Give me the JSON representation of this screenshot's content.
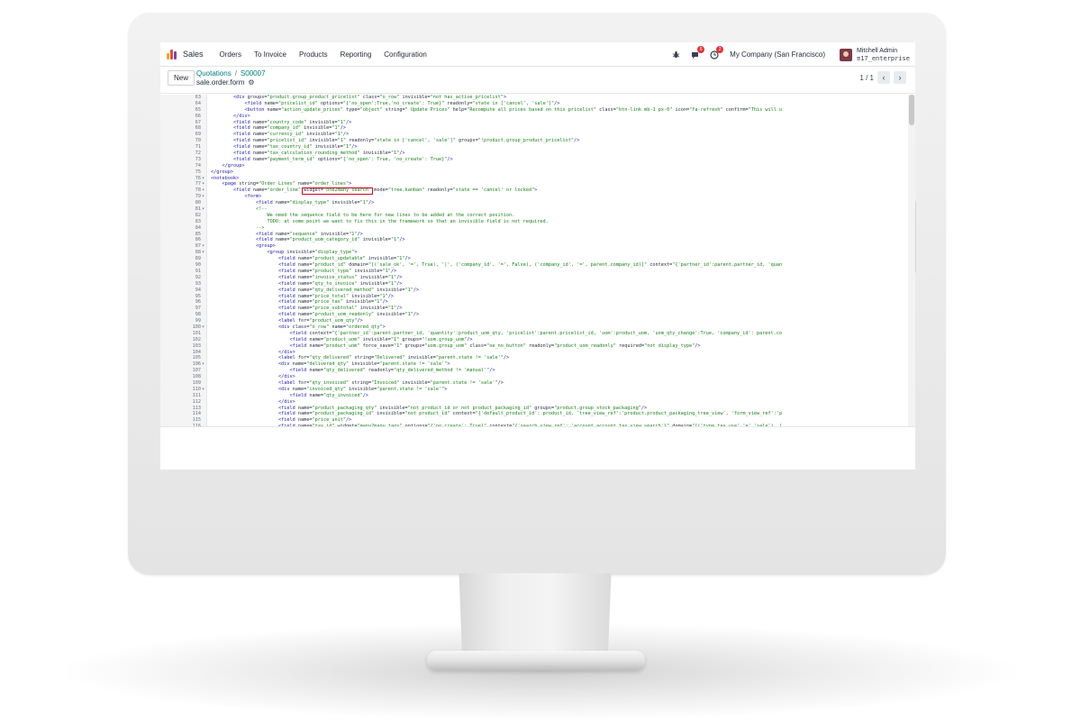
{
  "topbar": {
    "app_name": "Sales",
    "menu": [
      "Orders",
      "To Invoice",
      "Products",
      "Reporting",
      "Configuration"
    ],
    "icons": {
      "bug": "bug-icon",
      "chat": "chat-icon",
      "activity": "clock-icon"
    },
    "chat_badge": "6",
    "activity_badge": "2",
    "company": "My Company (San Francisco)",
    "user_name": "Mitchell Admin",
    "user_db": "17_enterprise"
  },
  "control": {
    "new_label": "New",
    "breadcrumb_parent": "Quotations",
    "breadcrumb_separator": "/",
    "breadcrumb_current": "S00007",
    "record_title": "sale.order.form",
    "pager": "1 / 1"
  },
  "colors": {
    "tag": "#1a1aa6",
    "attr_name": "#1f2937",
    "attr_value": "#1a7f1a",
    "comment": "#1a7f1a",
    "accent": "#017e84",
    "highlight_box": "#d0021b"
  },
  "editor": {
    "lines": [
      {
        "n": "63",
        "fold": "",
        "code": "        <div groups=\"product.group_product_pricelist\" class=\"o_row\" invisible=\"not has_active_pricelist\">"
      },
      {
        "n": "64",
        "fold": "",
        "code": "            <field name=\"pricelist_id\" options=\"{'no_open':True,'no_create': True}\" readonly=\"state in ['cancel', 'sale']\"/>"
      },
      {
        "n": "65",
        "fold": "",
        "code": "            <button name=\"action_update_prices\" type=\"object\" string=\" Update Prices\" help=\"Recompute all prices based on this pricelist\" class=\"btn-link mb-1 px-0\" icon=\"fa-refresh\" confirm=\"This will u"
      },
      {
        "n": "66",
        "fold": "",
        "code": "        </div>"
      },
      {
        "n": "67",
        "fold": "",
        "code": "        <field name=\"country_code\" invisible=\"1\"/>"
      },
      {
        "n": "68",
        "fold": "",
        "code": "        <field name=\"company_id\" invisible=\"1\"/>"
      },
      {
        "n": "69",
        "fold": "",
        "code": "        <field name=\"currency_id\" invisible=\"1\"/>"
      },
      {
        "n": "70",
        "fold": "",
        "code": "        <field name=\"pricelist_id\" invisible=\"1\" readonly=\"state in ['cancel', 'sale']\" groups=\"!product.group_product_pricelist\"/>"
      },
      {
        "n": "71",
        "fold": "",
        "code": "        <field name=\"tax_country_id\" invisible=\"1\"/>"
      },
      {
        "n": "72",
        "fold": "",
        "code": "        <field name=\"tax_calculation_rounding_method\" invisible=\"1\"/>"
      },
      {
        "n": "73",
        "fold": "",
        "code": "        <field name=\"payment_term_id\" options=\"{'no_open': True, 'no_create': True}\"/>"
      },
      {
        "n": "74",
        "fold": "",
        "code": "    </group>"
      },
      {
        "n": "75",
        "fold": "",
        "code": "</group>"
      },
      {
        "n": "76",
        "fold": "▾",
        "code": "<notebook>"
      },
      {
        "n": "77",
        "fold": "▾",
        "code": "    <page string=\"Order Lines\" name=\"order_lines\">"
      },
      {
        "n": "78",
        "fold": "▾",
        "code": "        <field name=\"order_line\" widget=\"one2many_search\" mode=\"tree,kanban\" readonly=\"state == 'cancel' or locked\">"
      },
      {
        "n": "79",
        "fold": "▾",
        "code": "            <form>"
      },
      {
        "n": "80",
        "fold": "",
        "code": "                <field name=\"display_type\" invisible=\"1\"/>"
      },
      {
        "n": "81",
        "fold": "▾",
        "code": "                <!--"
      },
      {
        "n": "82",
        "fold": "",
        "code": "                    We need the sequence field to be here for new lines to be added at the correct position."
      },
      {
        "n": "83",
        "fold": "",
        "code": "                    TODO: at some point we want to fix this in the framework so that an invisible field is not required."
      },
      {
        "n": "84",
        "fold": "",
        "code": "                -->"
      },
      {
        "n": "85",
        "fold": "",
        "code": "                <field name=\"sequence\" invisible=\"1\"/>"
      },
      {
        "n": "86",
        "fold": "",
        "code": "                <field name=\"product_uom_category_id\" invisible=\"1\"/>"
      },
      {
        "n": "87",
        "fold": "▾",
        "code": "                <group>"
      },
      {
        "n": "88",
        "fold": "▾",
        "code": "                    <group invisible=\"display_type\">"
      },
      {
        "n": "89",
        "fold": "",
        "code": "                        <field name=\"product_updatable\" invisible=\"1\"/>"
      },
      {
        "n": "90",
        "fold": "",
        "code": "                        <field name=\"product_id\" domain=\"[('sale_ok', '=', True), '|', ('company_id', '=', False), ('company_id', '=', parent.company_id)]\" context=\"{'partner_id':parent.partner_id, 'quan"
      },
      {
        "n": "91",
        "fold": "",
        "code": "                        <field name=\"product_type\" invisible=\"1\"/>"
      },
      {
        "n": "92",
        "fold": "",
        "code": "                        <field name=\"invoice_status\" invisible=\"1\"/>"
      },
      {
        "n": "93",
        "fold": "",
        "code": "                        <field name=\"qty_to_invoice\" invisible=\"1\"/>"
      },
      {
        "n": "94",
        "fold": "",
        "code": "                        <field name=\"qty_delivered_method\" invisible=\"1\"/>"
      },
      {
        "n": "95",
        "fold": "",
        "code": "                        <field name=\"price_total\" invisible=\"1\"/>"
      },
      {
        "n": "96",
        "fold": "",
        "code": "                        <field name=\"price_tax\" invisible=\"1\"/>"
      },
      {
        "n": "97",
        "fold": "",
        "code": "                        <field name=\"price_subtotal\" invisible=\"1\"/>"
      },
      {
        "n": "98",
        "fold": "",
        "code": "                        <field name=\"product_uom_readonly\" invisible=\"1\"/>"
      },
      {
        "n": "99",
        "fold": "",
        "code": "                        <label for=\"product_uom_qty\"/>"
      },
      {
        "n": "100",
        "fold": "▾",
        "code": "                        <div class=\"o_row\" name=\"ordered_qty\">"
      },
      {
        "n": "101",
        "fold": "",
        "code": "                            <field context=\"{'partner_id':parent.partner_id, 'quantity':product_uom_qty, 'pricelist':parent.pricelist_id, 'uom':product_uom, 'uom_qty_change':True, 'company_id': parent.co"
      },
      {
        "n": "102",
        "fold": "",
        "code": "                            <field name=\"product_uom\" invisible=\"1\" groups=\"!uom.group_uom\"/>"
      },
      {
        "n": "103",
        "fold": "",
        "code": "                            <field name=\"product_uom\" force_save=\"1\" groups=\"uom.group_uom\" class=\"oe_no_button\" readonly=\"product_uom_readonly\" required=\"not display_type\"/>"
      },
      {
        "n": "104",
        "fold": "",
        "code": "                        </div>"
      },
      {
        "n": "105",
        "fold": "",
        "code": "                        <label for=\"qty_delivered\" string=\"Delivered\" invisible=\"parent.state != 'sale'\"/>"
      },
      {
        "n": "106",
        "fold": "▾",
        "code": "                        <div name=\"delivered_qty\" invisible=\"parent.state != 'sale'\">"
      },
      {
        "n": "107",
        "fold": "",
        "code": "                            <field name=\"qty_delivered\" readonly=\"qty_delivered_method != 'manual'\"/>"
      },
      {
        "n": "108",
        "fold": "",
        "code": "                        </div>"
      },
      {
        "n": "109",
        "fold": "",
        "code": "                        <label for=\"qty_invoiced\" string=\"Invoiced\" invisible=\"parent.state != 'sale'\"/>"
      },
      {
        "n": "110",
        "fold": "▾",
        "code": "                        <div name=\"invoiced_qty\" invisible=\"parent.state != 'sale'\">"
      },
      {
        "n": "111",
        "fold": "",
        "code": "                            <field name=\"qty_invoiced\"/>"
      },
      {
        "n": "112",
        "fold": "",
        "code": "                        </div>"
      },
      {
        "n": "113",
        "fold": "",
        "code": "                        <field name=\"product_packaging_qty\" invisible=\"not product_id or not product_packaging_id\" groups=\"product.group_stock_packaging\"/>"
      },
      {
        "n": "114",
        "fold": "",
        "code": "                        <field name=\"product_packaging_id\" invisible=\"not product_id\" context=\"{'default_product_id': product_id, 'tree_view_ref':'product.product_packaging_tree_view', 'form_view_ref':'p"
      },
      {
        "n": "115",
        "fold": "",
        "code": "                        <field name=\"price_unit\"/>"
      },
      {
        "n": "116",
        "fold": "",
        "code": "                        <field name=\"tax_id\" widget=\"many2many_tags\" options=\"{'no_create': True}\" context=\"{'search_view_ref': 'account.account_tax_view_search'}\" domain=\"[('type_tax_use','=','sale'), ("
      }
    ]
  }
}
